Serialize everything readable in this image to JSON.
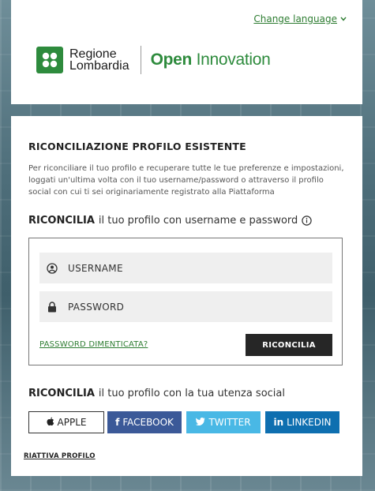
{
  "header": {
    "change_language": "Change language",
    "logo_line1": "Regione",
    "logo_line2": "Lombardia",
    "brand_bold": "Open",
    "brand_rest": " Innovation"
  },
  "main": {
    "title": "RICONCILIAZIONE PROFILO ESISTENTE",
    "description": "Per riconciliare il tuo profilo e recuperare tutte le tue preferenze e impostazioni, loggati un'ultima volta con il tuo username/password o attraverso il profilo social con cui ti sei originariamente registrato alla Piattaforma",
    "login_heading_bold": "RICONCILIA",
    "login_heading_rest": "il tuo profilo con username e password",
    "username_label": "USERNAME",
    "password_label": "PASSWORD",
    "forgot_password": "PASSWORD DIMENTICATA?",
    "submit_label": "RICONCILIA",
    "social_heading_bold": "RICONCILIA",
    "social_heading_rest": "il tuo profilo con la tua utenza social",
    "social": {
      "apple": "APPLE",
      "facebook": "FACEBOOK",
      "twitter": "TWITTER",
      "linkedin": "LINKEDIN"
    },
    "reactivate": "RIATTIVA PROFILO"
  },
  "colors": {
    "brand_green": "#2e8b3d",
    "facebook": "#3b5998",
    "twitter": "#49b8e5",
    "linkedin": "#0e6fb0",
    "dark_button": "#262626"
  }
}
